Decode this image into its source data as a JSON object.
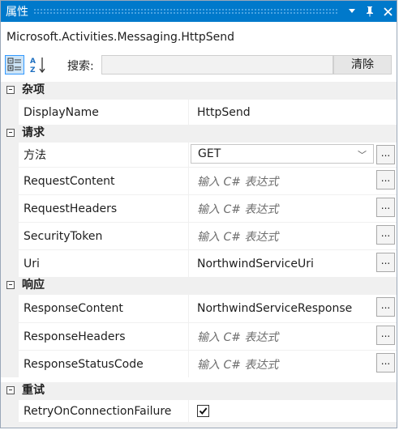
{
  "window": {
    "title": "属性",
    "title_icons": [
      "dropdown-icon",
      "pin-icon",
      "close-icon"
    ]
  },
  "object_type": "Microsoft.Activities.Messaging.HttpSend",
  "toolbar": {
    "search_label": "搜索:",
    "search_value": "",
    "clear_label": "清除",
    "categorized_icon": "categorized-view-icon",
    "alphabetical_icon": "sort-alphabetical-icon"
  },
  "colors": {
    "title_bar": "#0079cb",
    "category_bg": "#f0f0f0",
    "placeholder": "#6d6d6d"
  },
  "categories": [
    {
      "label": "杂项",
      "properties": [
        {
          "name": "DisplayName",
          "value": "HttpSend"
        }
      ]
    },
    {
      "label": "请求",
      "properties": [
        {
          "name": "方法",
          "value": "GET"
        },
        {
          "name": "RequestContent",
          "value": "输入 C# 表达式"
        },
        {
          "name": "RequestHeaders",
          "value": "输入 C# 表达式"
        },
        {
          "name": "SecurityToken",
          "value": "输入 C# 表达式"
        },
        {
          "name": "Uri",
          "value": "NorthwindServiceUri"
        }
      ]
    },
    {
      "label": "响应",
      "properties": [
        {
          "name": "ResponseContent",
          "value": "NorthwindServiceResponse"
        },
        {
          "name": "ResponseHeaders",
          "value": "输入 C# 表达式"
        },
        {
          "name": "ResponseStatusCode",
          "value": "输入 C# 表达式"
        }
      ]
    },
    {
      "label": "重试",
      "properties": [
        {
          "name": "RetryOnConnectionFailure",
          "checked": true
        }
      ]
    }
  ]
}
